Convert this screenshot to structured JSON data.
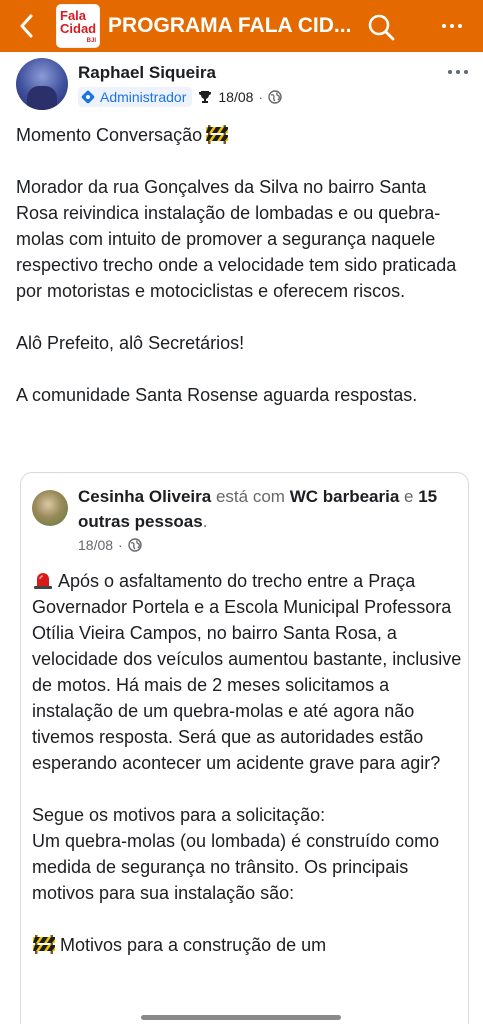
{
  "topbar": {
    "title": "PROGRAMA FALA CID...",
    "logo_line1": "Fala",
    "logo_line2": "Cidad",
    "logo_line3": "BJI",
    "bg_color": "#e46a00"
  },
  "post": {
    "author": "Raphael Siqueira",
    "role": "Administrador",
    "date": "18/08",
    "dot": "·",
    "title": "Momento Conversação",
    "body1": "Morador da rua Gonçalves da Silva no bairro Santa Rosa reivindica instalação de lombadas e ou quebra-molas com intuito de promover a segurança naquele respectivo trecho onde a velocidade tem sido praticada por motoristas e motociclistas e oferecem riscos.",
    "body2": "Alô Prefeito, alô Secretários!",
    "body3": "A comunidade Santa Rosense aguarda respostas."
  },
  "shared_post": {
    "author": "Cesinha Oliveira",
    "with_text": "está com",
    "tagged_place": "WC barbearia",
    "and_text": "e",
    "others": "15 outras pessoas",
    "period": ".",
    "date": "18/08",
    "dot": "·",
    "para1": "Após o asfaltamento do trecho entre a Praça Governador Portela e a Escola Municipal Professora Otília Vieira Campos, no bairro Santa Rosa, a velocidade dos veículos aumentou bastante, inclusive de motos. Há mais de 2 meses solicitamos a instalação de um quebra-molas e até agora não tivemos resposta. Será que as autoridades estão esperando acontecer um acidente grave para agir?",
    "para2_line1": "Segue os motivos para a solicitação:",
    "para2_line2": "Um quebra-molas (ou lombada) é construído como medida de segurança no trânsito. Os principais motivos para sua instalação são:",
    "para3": "Motivos para a construção de um"
  },
  "icons": {
    "back": "chevron-left-icon",
    "search": "search-icon",
    "more": "more-horizontal-icon",
    "admin": "admin-shield-icon",
    "trophy": "trophy-icon",
    "globe": "globe-icon",
    "construction": "construction-barrier-emoji",
    "siren": "siren-emoji"
  },
  "colors": {
    "accent": "#e46a00",
    "link_blue": "#1b74e4",
    "text": "#1c1e21",
    "muted": "#65676b"
  }
}
